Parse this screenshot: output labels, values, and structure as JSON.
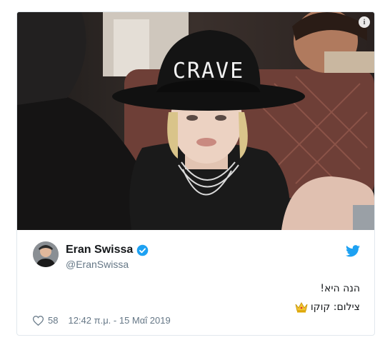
{
  "tweet": {
    "author_name": "Eran Swissa",
    "author_handle": "@EranSwissa",
    "text_line1": "הנה היא!",
    "text_line2": "צילום: קוקו",
    "likes": "58",
    "timestamp": "12:42 π.μ. - 15 Μαΐ 2019"
  },
  "photo": {
    "hat_text": "CRAVE",
    "info_icon": "i"
  },
  "colors": {
    "twitter_blue": "#1da1f2",
    "text_primary": "#14171a",
    "text_secondary": "#657786"
  }
}
